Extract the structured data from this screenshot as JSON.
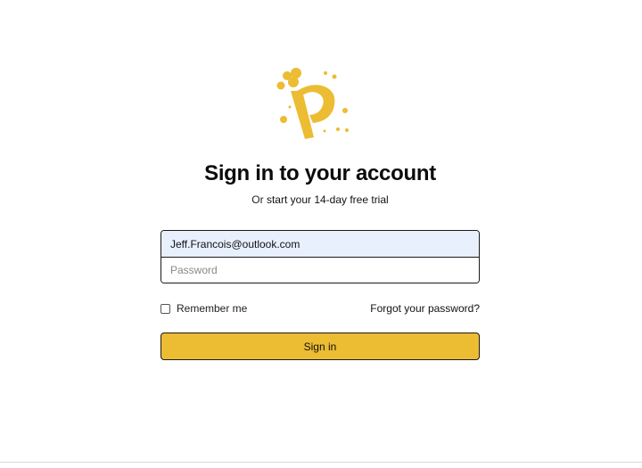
{
  "branding": {
    "logo_icon": "p-bubbles-logo-icon",
    "brand_color": "#ecbc32"
  },
  "heading": {
    "title": "Sign in to your account",
    "subtitle_prefix": "Or",
    "trial_link": "start your 14-day free trial"
  },
  "form": {
    "email_value": "Jeff.Francois@outlook.com",
    "password_placeholder": "Password",
    "remember_label": "Remember me",
    "remember_checked": false,
    "forgot_label": "Forgot your password?",
    "submit_label": "Sign in"
  }
}
